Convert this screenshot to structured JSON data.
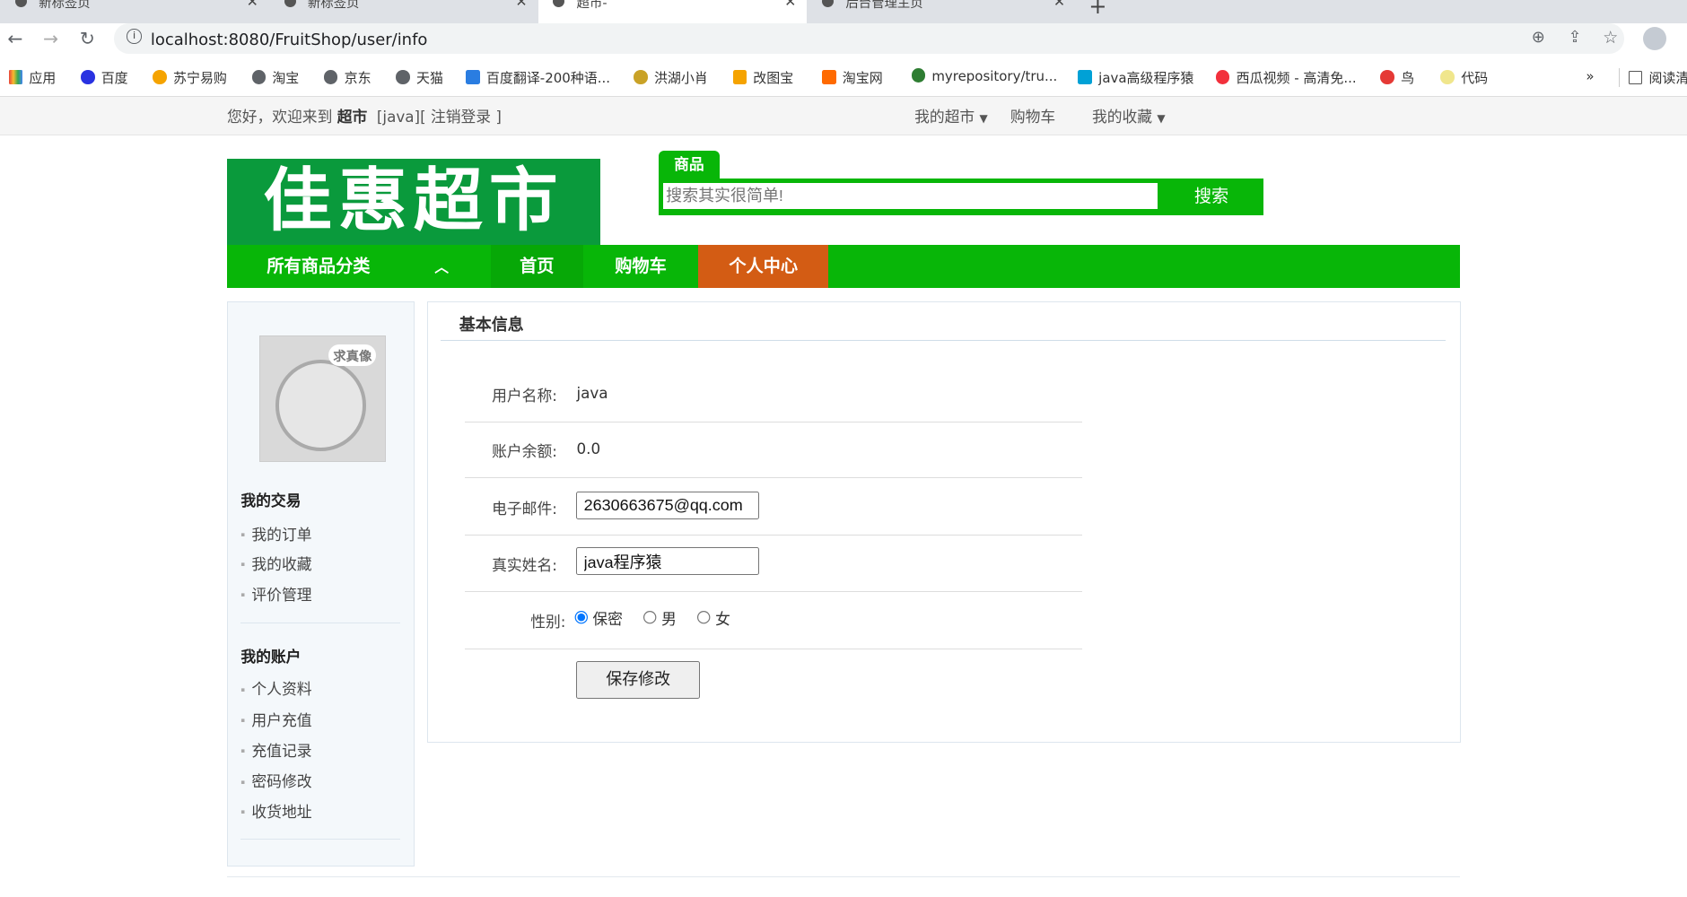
{
  "browser": {
    "tabs": [
      {
        "label": "新标签页"
      },
      {
        "label": "新标签页"
      },
      {
        "label": "超市-"
      },
      {
        "label": "后台管理主页"
      }
    ],
    "url": "localhost:8080/FruitShop/user/info",
    "bookmarks": [
      {
        "label": "应用",
        "color": "#e8453c"
      },
      {
        "label": "百度",
        "color": "#2932e1"
      },
      {
        "label": "苏宁易购",
        "color": "#f5a300"
      },
      {
        "label": "淘宝",
        "color": "#5f6368"
      },
      {
        "label": "京东",
        "color": "#5f6368"
      },
      {
        "label": "天猫",
        "color": "#5f6368"
      },
      {
        "label": "百度翻译-200种语...",
        "color": "#2a7de1"
      },
      {
        "label": "洪湖小肖",
        "color": "#c9a227"
      },
      {
        "label": "改图宝",
        "color": "#f5a300"
      },
      {
        "label": "淘宝网",
        "color": "#ff6a00"
      },
      {
        "label": "myrepository/tru...",
        "color": "#2e7d32"
      },
      {
        "label": "java高级程序猿",
        "color": "#00a1d6"
      },
      {
        "label": "西瓜视频 - 高清免...",
        "color": "#f2303c"
      },
      {
        "label": "鸟",
        "color": "#e53935"
      },
      {
        "label": "代码",
        "color": "#f0e68c"
      }
    ],
    "more": "»",
    "reading": "阅读清"
  },
  "topbar": {
    "greeting": "您好，欢迎来到",
    "shop": "超市",
    "user": "[java]",
    "logout": "[ 注销登录 ]",
    "my_shop": "我的超市",
    "cart": "购物车",
    "favorites": "我的收藏"
  },
  "header": {
    "logo": "佳惠超市",
    "search_tab": "商品",
    "search_placeholder": "搜索其实很简单!",
    "search_button": "搜索"
  },
  "nav": {
    "categories": "所有商品分类",
    "home": "首页",
    "cart": "购物车",
    "personal": "个人中心",
    "active_color": "#d35c14",
    "brand_color": "#08b608"
  },
  "sidebar": {
    "avatar_caption": "求真像",
    "sections": [
      {
        "title": "我的交易",
        "items": [
          "我的订单",
          "我的收藏",
          "评价管理"
        ]
      },
      {
        "title": "我的账户",
        "items": [
          "个人资料",
          "用户充值",
          "充值记录",
          "密码修改",
          "收货地址"
        ]
      }
    ]
  },
  "main": {
    "title": "基本信息",
    "username_label": "用户名称:",
    "username": "java",
    "balance_label": "账户余额:",
    "balance": "0.0",
    "email_label": "电子邮件:",
    "email": "2630663675@qq.com",
    "realname_label": "真实姓名:",
    "realname": "java程序猿",
    "gender_label": "性别:",
    "gender_options": [
      "保密",
      "男",
      "女"
    ],
    "gender_selected": "保密",
    "save": "保存修改"
  }
}
